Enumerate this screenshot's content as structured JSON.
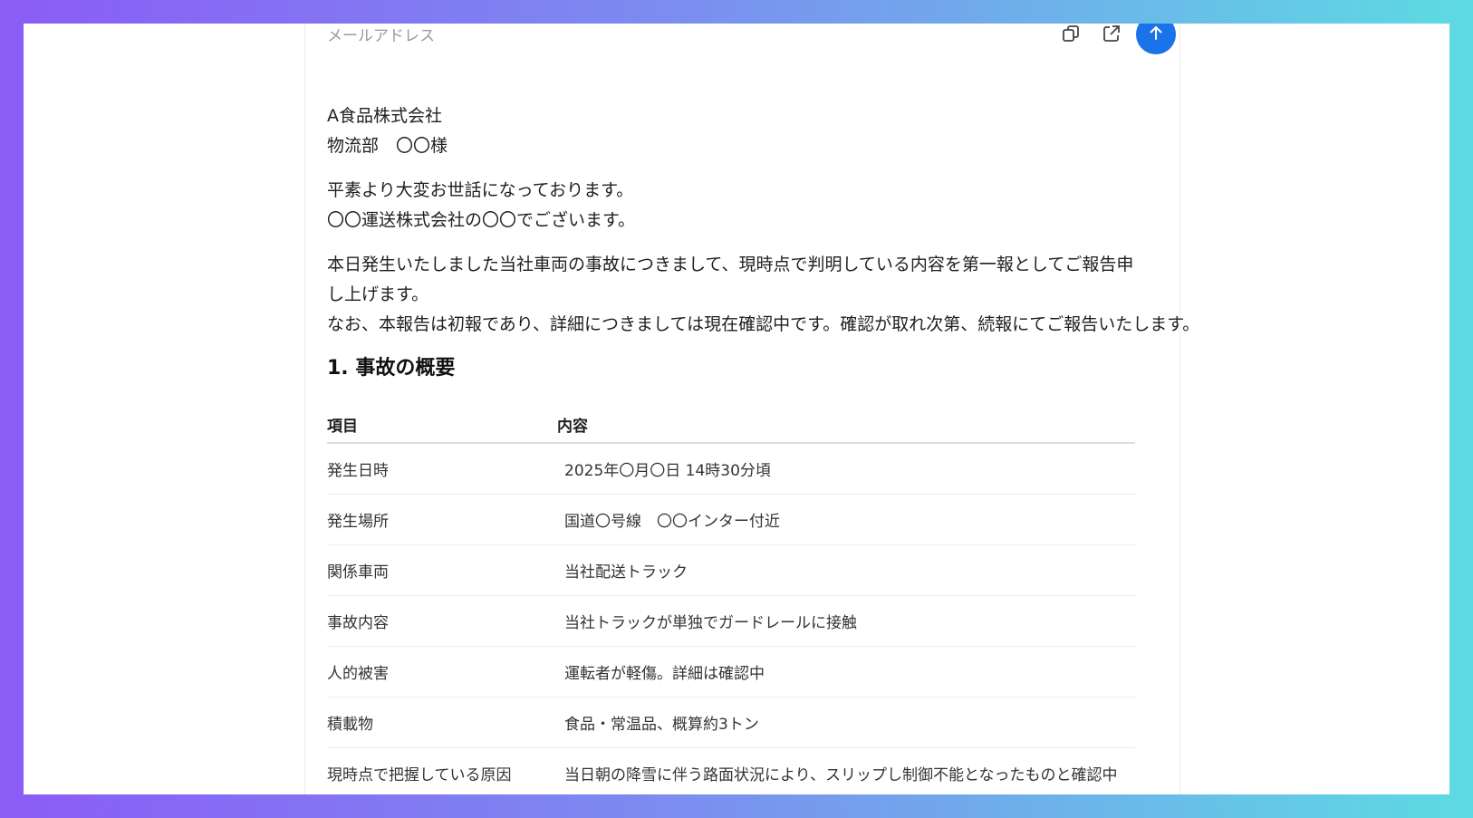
{
  "header": {
    "field_label": "メールアドレス",
    "copy_icon": "copy-icon",
    "open_icon": "open-in-new-icon",
    "send_icon": "arrow-up-icon"
  },
  "email": {
    "addressee": [
      "A食品株式会社",
      "物流部　〇〇様"
    ],
    "greeting": [
      "平素より大変お世話になっております。",
      "〇〇運送株式会社の〇〇でございます。"
    ],
    "notice": [
      "本日発生いたしました当社車両の事故につきまして、現時点で判明している内容を第一報としてご報告申し上げます。",
      "なお、本報告は初報であり、詳細につきましては現在確認中です。確認が取れ次第、続報にてご報告いたします。"
    ],
    "section_heading": "1. 事故の概要",
    "table": {
      "headers": [
        "項目",
        "内容"
      ],
      "rows": [
        [
          "発生日時",
          "2025年〇月〇日 14時30分頃"
        ],
        [
          "発生場所",
          "国道〇号線　〇〇インター付近"
        ],
        [
          "関係車両",
          "当社配送トラック"
        ],
        [
          "事故内容",
          "当社トラックが単独でガードレールに接触"
        ],
        [
          "人的被害",
          "運転者が軽傷。詳細は確認中"
        ],
        [
          "積載物",
          "食品・常温品、概算約3トン"
        ],
        [
          "現時点で把握している原因",
          "当日朝の降雪に伴う路面状況により、スリップし制御不能となったものと確認中"
        ]
      ]
    }
  },
  "colors": {
    "accent": "#1a73e8",
    "gradient_start": "#8b5cf6",
    "gradient_end": "#5ddbe3"
  }
}
